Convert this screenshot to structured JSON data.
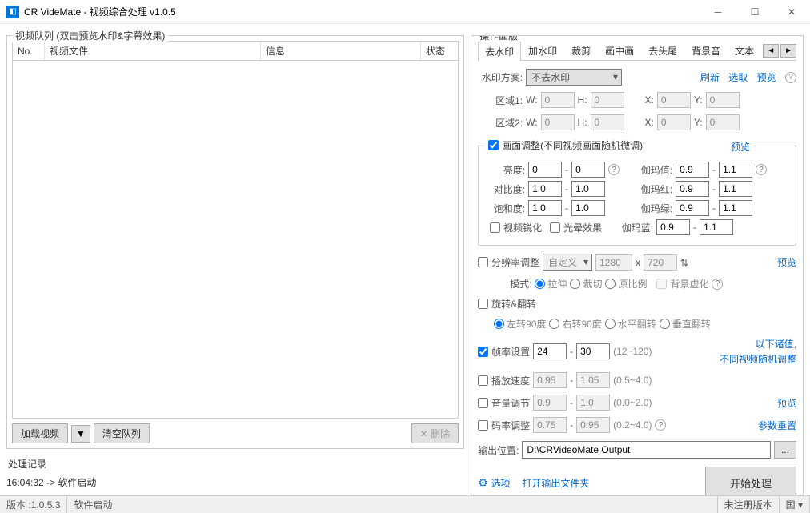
{
  "window": {
    "title": "CR VideMate - 视频综合处理 v1.0.5"
  },
  "left": {
    "queue_legend": "视频队列 (双击预览水印&字幕效果)",
    "cols": {
      "no": "No.",
      "file": "视频文件",
      "info": "信息",
      "status": "状态"
    },
    "load": "加载视频",
    "clear": "清空队列",
    "delete": "删除",
    "log_legend": "处理记录",
    "log_line": "16:04:32 -> 软件启动"
  },
  "right": {
    "legend": "操作面版",
    "tabs": {
      "t1": "去水印",
      "t2": "加水印",
      "t3": "裁剪",
      "t4": "画中画",
      "t5": "去头尾",
      "t6": "背景音",
      "t7": "文本"
    },
    "wm": {
      "scheme_lbl": "水印方案:",
      "scheme_val": "不去水印",
      "refresh": "刷新",
      "pick": "选取",
      "preview": "预览",
      "r1": "区域1:",
      "r2": "区域2:",
      "w": "W:",
      "h": "H:",
      "x": "X:",
      "y": "Y:",
      "v": "0"
    },
    "adj": {
      "chk": "画面调整(不同视频画面随机微调)",
      "preview": "预览",
      "bright": "亮度:",
      "contrast": "对比度:",
      "sat": "饱和度:",
      "gamma": "伽玛值:",
      "gr": "伽玛红:",
      "gg": "伽玛绿:",
      "gb": "伽玛蓝:",
      "v0": "0",
      "v1": "1.0",
      "v09": "0.9",
      "v11": "1.1",
      "sharpen": "视频锐化",
      "glow": "光晕效果"
    },
    "res": {
      "chk": "分辨率调整",
      "custom": "自定义",
      "w": "1280",
      "h": "720",
      "x": "x",
      "preview": "预览",
      "mode": "模式:",
      "m1": "拉伸",
      "m2": "裁切",
      "m3": "原比例",
      "bg": "背景虚化"
    },
    "rot": {
      "chk": "旋转&翻转",
      "l90": "左转90度",
      "r90": "右转90度",
      "hflip": "水平翻转",
      "vflip": "垂直翻转"
    },
    "fps": {
      "chk": "帧率设置",
      "a": "24",
      "b": "30",
      "hint": "(12~120)",
      "note1": "以下诸值,",
      "note2": "不同视频随机调整"
    },
    "speed": {
      "chk": "播放速度",
      "a": "0.95",
      "b": "1.05",
      "hint": "(0.5~4.0)"
    },
    "vol": {
      "chk": "音量调节",
      "a": "0.9",
      "b": "1.0",
      "hint": "(0.0~2.0)",
      "preview": "预览"
    },
    "br": {
      "chk": "码率调整",
      "a": "0.75",
      "b": "0.95",
      "hint": "(0.2~4.0)",
      "reset": "参数重置"
    },
    "out": {
      "lbl": "输出位置:",
      "path": "D:\\CRVideoMate Output",
      "browse": "..."
    },
    "foot": {
      "opts": "选项",
      "openout": "打开输出文件夹",
      "start": "开始处理"
    }
  },
  "status": {
    "ver_lbl": "版本 : ",
    "ver": "1.0.5.3",
    "msg": "软件启动",
    "unreg": "未注册版本"
  }
}
